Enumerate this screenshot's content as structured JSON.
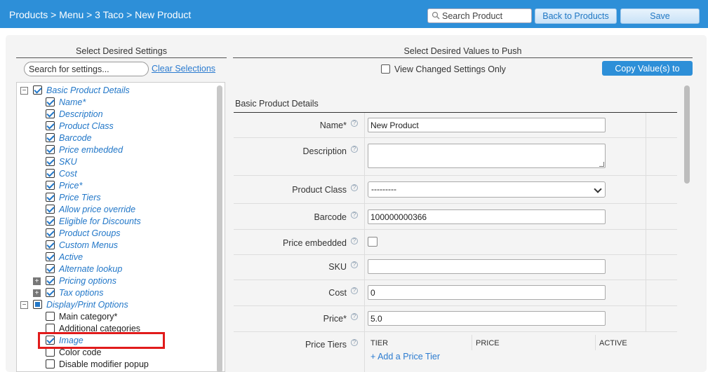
{
  "topbar": {
    "breadcrumb": "Products > Menu > 3 Taco > New Product",
    "search_placeholder": "Search Product",
    "back_label": "Back to Products",
    "save_label": "Save"
  },
  "left": {
    "title": "Select Desired Settings",
    "search_placeholder": "Search for settings...",
    "clear_label": "Clear Selections",
    "tree": [
      {
        "label": "Basic Product Details",
        "level": 0,
        "state": "on",
        "toggle": "minus",
        "style": "blue"
      },
      {
        "label": "Name*",
        "level": 1,
        "state": "on",
        "style": "blue"
      },
      {
        "label": "Description",
        "level": 1,
        "state": "on",
        "style": "blue"
      },
      {
        "label": "Product Class",
        "level": 1,
        "state": "on",
        "style": "blue"
      },
      {
        "label": "Barcode",
        "level": 1,
        "state": "on",
        "style": "blue"
      },
      {
        "label": "Price embedded",
        "level": 1,
        "state": "on",
        "style": "blue"
      },
      {
        "label": "SKU",
        "level": 1,
        "state": "on",
        "style": "blue"
      },
      {
        "label": "Cost",
        "level": 1,
        "state": "on",
        "style": "blue"
      },
      {
        "label": "Price*",
        "level": 1,
        "state": "on",
        "style": "blue"
      },
      {
        "label": "Price Tiers",
        "level": 1,
        "state": "on",
        "style": "blue"
      },
      {
        "label": "Allow price override",
        "level": 1,
        "state": "on",
        "style": "blue"
      },
      {
        "label": "Eligible for Discounts",
        "level": 1,
        "state": "on",
        "style": "blue"
      },
      {
        "label": "Product Groups",
        "level": 1,
        "state": "on",
        "style": "blue"
      },
      {
        "label": "Custom Menus",
        "level": 1,
        "state": "on",
        "style": "blue"
      },
      {
        "label": "Active",
        "level": 1,
        "state": "on",
        "style": "blue"
      },
      {
        "label": "Alternate lookup",
        "level": 1,
        "state": "on",
        "style": "blue"
      },
      {
        "label": "Pricing options",
        "level": 1,
        "state": "on",
        "toggle": "plus",
        "style": "blue"
      },
      {
        "label": "Tax options",
        "level": 1,
        "state": "on",
        "toggle": "plus",
        "style": "blue"
      },
      {
        "label": "Display/Print Options",
        "level": 0,
        "state": "part",
        "toggle": "minus",
        "style": "blue"
      },
      {
        "label": "Main category*",
        "level": 1,
        "state": "off",
        "style": "plain"
      },
      {
        "label": "Additional categories",
        "level": 1,
        "state": "off",
        "style": "plain"
      },
      {
        "label": "Image",
        "level": 1,
        "state": "on",
        "style": "blue"
      },
      {
        "label": "Color code",
        "level": 1,
        "state": "off",
        "style": "plain"
      },
      {
        "label": "Disable modifier popup",
        "level": 1,
        "state": "off",
        "style": "plain"
      }
    ]
  },
  "right": {
    "title": "Select Desired Values to Push",
    "changed_only_label": "View Changed Settings Only",
    "copy_label": "Copy Value(s) to",
    "section_title": "Basic Product Details",
    "fields": {
      "name": {
        "label": "Name*",
        "value": "New Product"
      },
      "description": {
        "label": "Description",
        "value": ""
      },
      "product_class": {
        "label": "Product Class",
        "value": "---------"
      },
      "barcode": {
        "label": "Barcode",
        "value": "100000000366"
      },
      "price_embedded": {
        "label": "Price embedded"
      },
      "sku": {
        "label": "SKU",
        "value": ""
      },
      "cost": {
        "label": "Cost",
        "value": "0"
      },
      "price": {
        "label": "Price*",
        "value": "5.0"
      },
      "price_tiers": {
        "label": "Price Tiers",
        "columns": [
          "TIER",
          "PRICE",
          "ACTIVE"
        ],
        "add_label": "+  Add a Price Tier"
      }
    }
  },
  "colors": {
    "topbar": "#2d8fd8",
    "link": "#2b7bd0",
    "highlight": "#e11b1b"
  }
}
